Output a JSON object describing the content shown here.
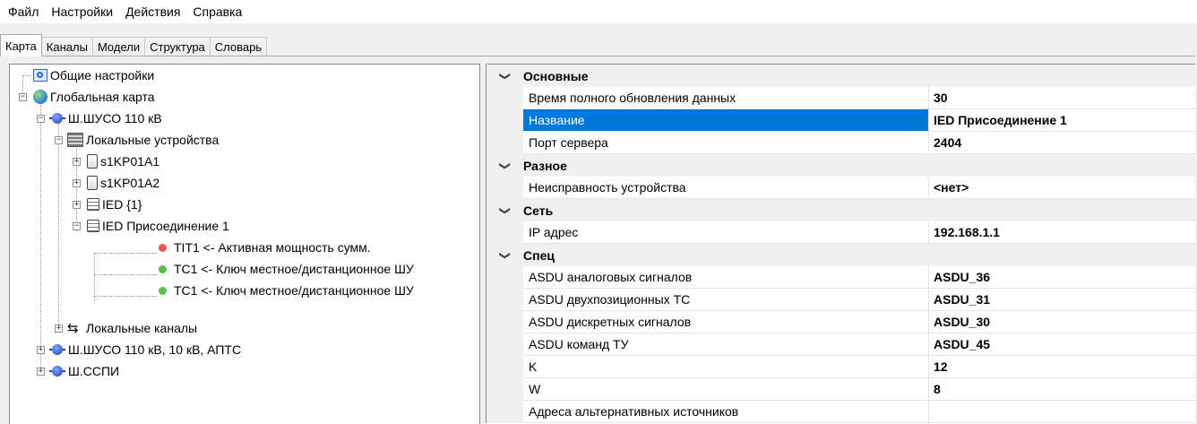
{
  "menu": [
    "Файл",
    "Настройки",
    "Действия",
    "Справка"
  ],
  "tabs": [
    "Карта",
    "Каналы",
    "Модели",
    "Структура",
    "Словарь"
  ],
  "tree": {
    "general_settings": "Общие настройки",
    "global_map": "Глобальная карта",
    "station1": "Ш.ШУСО 110 кВ",
    "local_devices": "Локальные устройства",
    "dev1": "s1KP01A1",
    "dev2": "s1KP01A2",
    "dev3": "IED {1}",
    "dev4": "IED Присоединение 1",
    "sig1": "TIT1 <-  Активная мощность сумм.",
    "sig2": "TC1 <- Ключ местное/дистанционное ШУ",
    "sig3": "TC1 <- Ключ местное/дистанционное ШУ",
    "local_channels": "Локальные каналы",
    "station2": "Ш.ШУСО 110 кВ, 10 кВ, АПТС",
    "station3": "Ш.ССПИ"
  },
  "props": {
    "cat_main": "Основные",
    "full_update_label": "Время полного обновления данных",
    "full_update_value": "30",
    "name_label": "Название",
    "name_value": "IED Присоединение 1",
    "port_label": "Порт сервера",
    "port_value": "2404",
    "cat_misc": "Разное",
    "fault_label": "Неисправность устройства",
    "fault_value": "<нет>",
    "cat_net": "Сеть",
    "ip_label": "IP адрес",
    "ip_value": "192.168.1.1",
    "cat_spec": "Спец",
    "asdu_analog_label": "ASDU аналоговых сигналов",
    "asdu_analog_value": "ASDU_36",
    "asdu_double_label": "ASDU двухпозиционных ТС",
    "asdu_double_value": "ASDU_31",
    "asdu_discrete_label": "ASDU дискретных сигналов",
    "asdu_discrete_value": "ASDU_30",
    "asdu_cmd_label": "ASDU команд ТУ",
    "asdu_cmd_value": "ASDU_45",
    "k_label": "K",
    "k_value": "12",
    "w_label": "W",
    "w_value": "8",
    "alt_sources_label": "Адреса альтернативных источников",
    "alt_sources_value": ""
  }
}
